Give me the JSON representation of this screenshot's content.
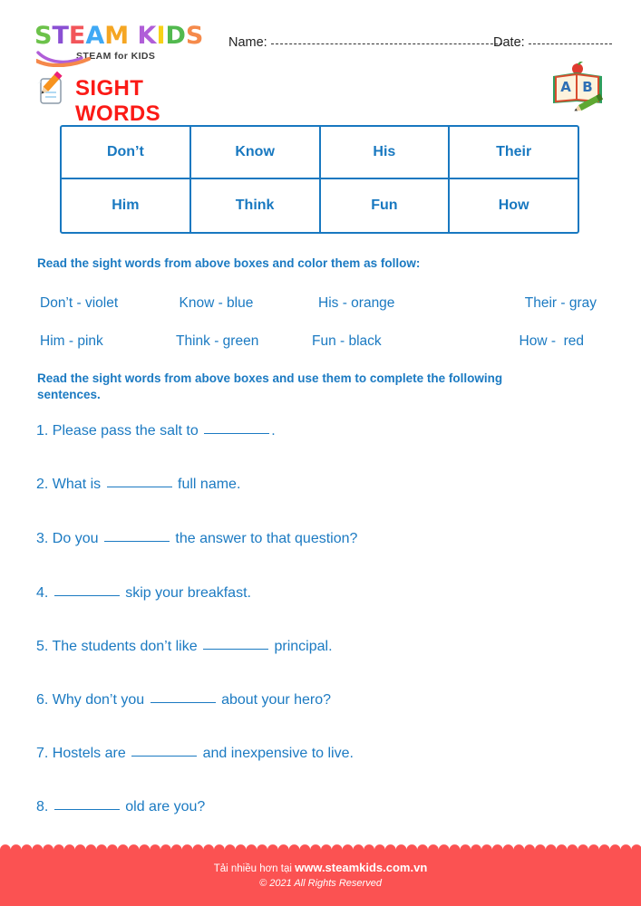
{
  "brand": {
    "logo_text": "STEAM KIDS",
    "logo_letters": [
      {
        "ch": "S",
        "color": "#6cc24a"
      },
      {
        "ch": "T",
        "color": "#8a4fd3"
      },
      {
        "ch": "E",
        "color": "#f2555a"
      },
      {
        "ch": "A",
        "color": "#3fa9f5"
      },
      {
        "ch": "M",
        "color": "#f5a623"
      },
      {
        "ch": " ",
        "color": "#ffffff"
      },
      {
        "ch": "K",
        "color": "#b05ed8"
      },
      {
        "ch": "I",
        "color": "#f7d117"
      },
      {
        "ch": "D",
        "color": "#52b94f"
      },
      {
        "ch": "S",
        "color": "#f58a4b"
      }
    ],
    "logo_tagline": "STEAM for KIDS"
  },
  "header": {
    "name_label": "Name:",
    "name_value": "",
    "date_label": "Date:",
    "date_value": "",
    "title": "SIGHT WORDS",
    "title_color": "#fb1a16",
    "notepad_icon": "pencil-notepad-icon",
    "abc_icon": "abc-book-icon"
  },
  "word_table": {
    "rows": [
      [
        "Don’t",
        "Know",
        "His",
        "Their"
      ],
      [
        "Him",
        "Think",
        "Fun",
        "How"
      ]
    ]
  },
  "instructions": {
    "color_task": "Read the sight words from above boxes and color them as follow:",
    "sentence_task": "Read the sight words from above boxes and use them to complete the following sentences."
  },
  "color_key": {
    "row1": [
      "Don’t - violet",
      "Know - blue",
      "His - orange",
      "Their - gray"
    ],
    "row2": [
      "Him - pink",
      "Think - green",
      "Fun - black",
      "How -  red"
    ]
  },
  "sentences": [
    {
      "num": "1.",
      "before": " Please pass the salt to ",
      "after": "."
    },
    {
      "num": "2.",
      "before": " What is ",
      "after": " full name."
    },
    {
      "num": "3.",
      "before": " Do you ",
      "after": " the answer to that question?"
    },
    {
      "num": "4.",
      "before": " ",
      "after": " skip your breakfast."
    },
    {
      "num": "5.",
      "before": " The students don’t like ",
      "after": " principal."
    },
    {
      "num": "6.",
      "before": " Why don’t you ",
      "after": " about your hero?"
    },
    {
      "num": "7.",
      "before": " Hostels are ",
      "after": " and inexpensive to live."
    },
    {
      "num": "8.",
      "before": " ",
      "after": " old are you?"
    }
  ],
  "footer": {
    "line1_prefix": "Tải nhiều hơn tại ",
    "line1_site": "www.steamkids.com.vn",
    "line2": "© 2021 All Rights Reserved",
    "background": "#fb5252"
  },
  "theme": {
    "blue": "#1b7ac2",
    "table_border": "#1878c0",
    "red": "#fb1a16"
  }
}
